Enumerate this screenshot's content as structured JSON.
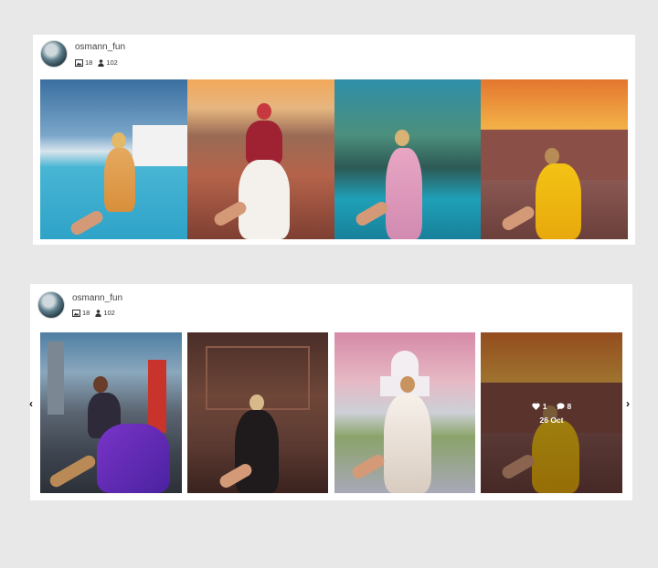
{
  "feed1": {
    "username": "osmann_fun",
    "images_count": "18",
    "followers_count": "102"
  },
  "feed2": {
    "username": "osmann_fun",
    "images_count": "18",
    "followers_count": "102",
    "prev_arrow": "‹",
    "next_arrow": "›",
    "hover": {
      "likes": "1",
      "comments": "8",
      "date": "26 Oct"
    }
  },
  "icons": {
    "images": "image-icon",
    "followers": "user-icon",
    "likes": "heart-icon",
    "comments": "comment-icon"
  }
}
